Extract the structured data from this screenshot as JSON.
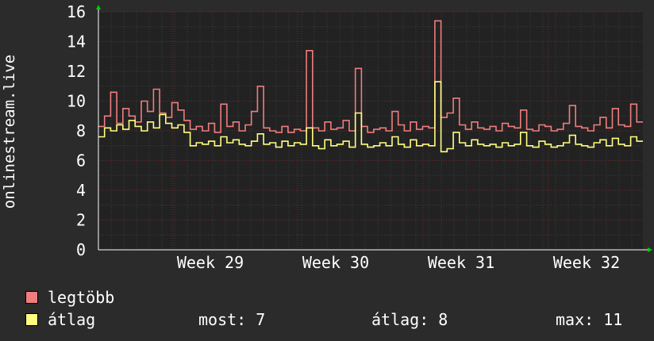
{
  "chart_data": {
    "type": "line",
    "ylabel": "onlinestream.live",
    "ylim": [
      0,
      16
    ],
    "yticks": [
      0,
      2,
      4,
      6,
      8,
      10,
      12,
      14,
      16
    ],
    "xlabels": [
      "Week 29",
      "Week 30",
      "Week 31",
      "Week 32"
    ],
    "grid": true,
    "series": [
      {
        "name": "legtöbb",
        "color": "#f07c7e",
        "values": [
          8.3,
          9.0,
          10.6,
          8.5,
          9.5,
          9.0,
          8.6,
          10.0,
          9.3,
          10.8,
          9.2,
          8.9,
          9.9,
          9.4,
          8.7,
          8.1,
          8.3,
          8.0,
          8.5,
          7.9,
          9.8,
          8.3,
          8.6,
          8.0,
          8.4,
          9.3,
          11.0,
          8.2,
          8.0,
          7.9,
          8.3,
          7.9,
          8.1,
          8.0,
          13.4,
          8.2,
          8.0,
          8.6,
          8.1,
          8.2,
          8.7,
          8.0,
          12.2,
          8.3,
          7.9,
          8.1,
          8.2,
          8.0,
          9.3,
          8.4,
          8.0,
          8.6,
          8.1,
          8.3,
          8.2,
          15.4,
          8.9,
          9.2,
          10.2,
          8.4,
          8.1,
          8.6,
          8.2,
          8.1,
          8.3,
          8.0,
          8.5,
          8.3,
          8.2,
          9.4,
          8.1,
          8.0,
          8.4,
          8.3,
          8.0,
          8.1,
          8.5,
          9.7,
          8.3,
          8.2,
          8.0,
          8.4,
          8.9,
          8.2,
          9.5,
          8.4,
          8.3,
          9.8,
          8.6
        ]
      },
      {
        "name": "átlag",
        "color": "#ffff80",
        "values": [
          7.6,
          8.2,
          8.0,
          8.4,
          8.1,
          8.7,
          8.3,
          8.0,
          8.6,
          8.2,
          9.1,
          8.5,
          8.2,
          8.4,
          7.9,
          7.0,
          7.2,
          7.1,
          7.3,
          7.0,
          7.6,
          7.2,
          7.4,
          7.1,
          7.0,
          7.3,
          7.8,
          7.1,
          7.2,
          6.9,
          7.3,
          7.0,
          7.2,
          7.1,
          8.2,
          7.0,
          6.8,
          7.4,
          7.0,
          7.1,
          7.3,
          6.9,
          9.2,
          7.1,
          6.9,
          7.0,
          7.2,
          7.0,
          7.6,
          7.1,
          6.9,
          7.4,
          7.0,
          7.1,
          7.0,
          11.3,
          6.6,
          6.8,
          7.9,
          7.2,
          7.0,
          7.4,
          7.1,
          7.0,
          7.1,
          6.9,
          7.2,
          7.0,
          7.1,
          7.9,
          7.0,
          6.9,
          7.3,
          7.1,
          6.9,
          7.0,
          7.2,
          7.7,
          7.1,
          7.0,
          6.9,
          7.2,
          7.4,
          7.0,
          7.5,
          7.1,
          7.0,
          7.6,
          7.3
        ]
      }
    ]
  },
  "legend": {
    "max_label": "legtöbb",
    "avg_label": "átlag",
    "max_color": "#f07c7e",
    "avg_color": "#ffff80"
  },
  "stats": {
    "now": "most: 7",
    "avg": "átlag: 8",
    "max": "max: 11"
  }
}
